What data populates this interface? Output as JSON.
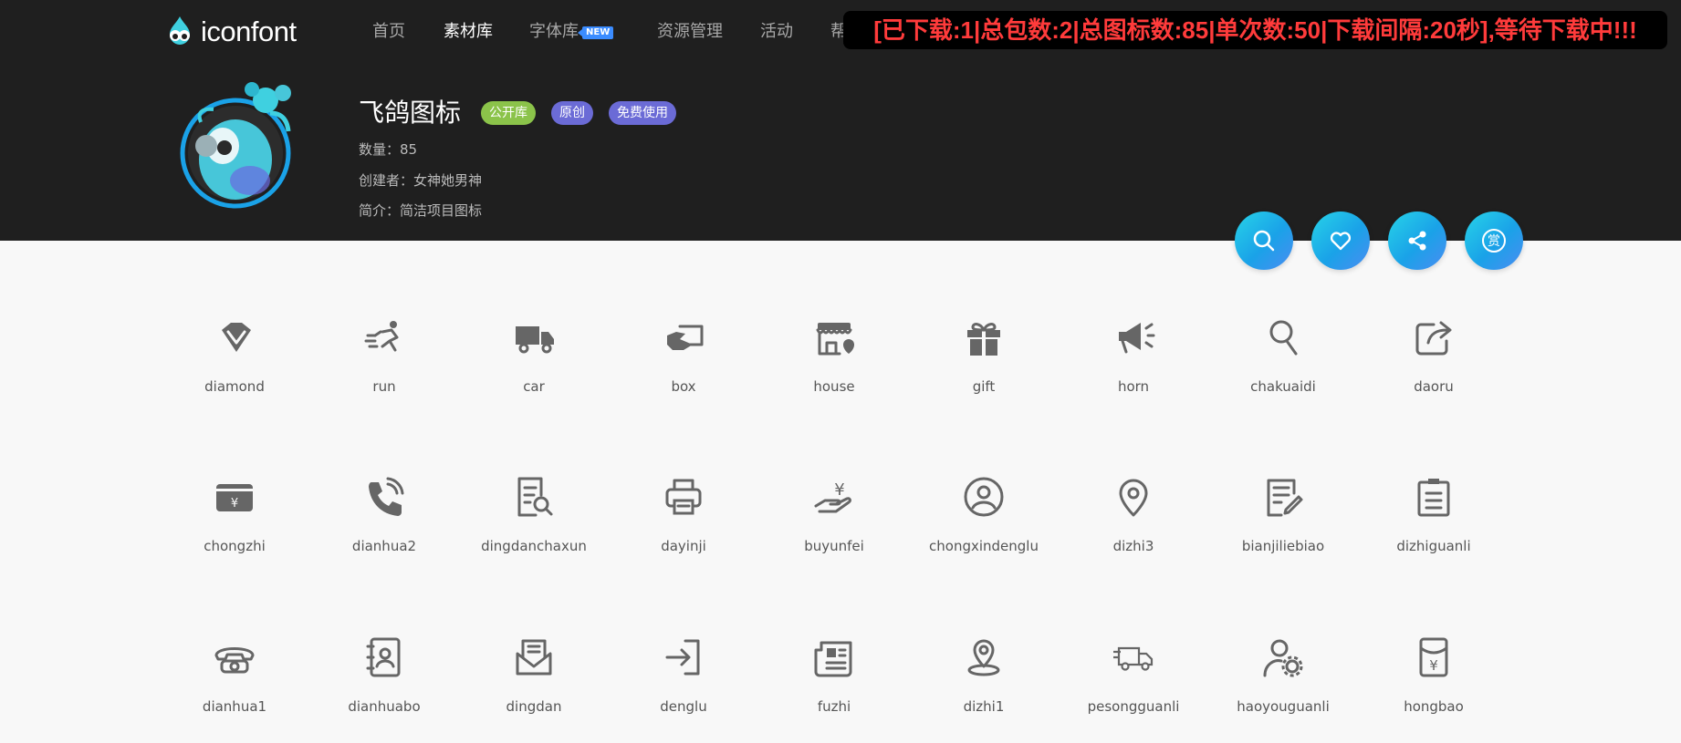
{
  "app": {
    "logo_text": "iconfont"
  },
  "nav": {
    "items": [
      {
        "label": "首页"
      },
      {
        "label": "素材库"
      },
      {
        "label": "字体库",
        "badge": "NEW"
      },
      {
        "label": "资源管理"
      },
      {
        "label": "活动"
      },
      {
        "label": "帮"
      }
    ],
    "active_index": 1
  },
  "banner": {
    "text": "[已下载:1|总包数:2|总图标数:85|单次数:50|下载间隔:20秒],等待下载中!!!"
  },
  "library": {
    "title": "飞鸽图标",
    "tags": [
      "公开库",
      "原创",
      "免费使用"
    ],
    "count_label": "数量：",
    "count_value": "85",
    "creator_label": "创建者：",
    "creator_value": "女神她男神",
    "desc_label": "简介：",
    "desc_value": "简洁项目图标"
  },
  "actions": [
    {
      "name": "search-icon"
    },
    {
      "name": "heart-icon"
    },
    {
      "name": "share-icon"
    },
    {
      "name": "reward-icon",
      "glyph": "赏"
    }
  ],
  "colors": {
    "hero_bg": "#1f1f1f",
    "banner_text": "#ff3b3b",
    "tag_green": "#8bc34a",
    "tag_purple": "#6b6bd6",
    "fab_gradient_start": "#27d3e8",
    "fab_gradient_end": "#4b8cf2",
    "icon_gray": "#666666"
  },
  "icons": [
    {
      "label": "diamond",
      "icon": "diamond-icon"
    },
    {
      "label": "run",
      "icon": "run-icon"
    },
    {
      "label": "car",
      "icon": "truck-icon"
    },
    {
      "label": "box",
      "icon": "box-icon"
    },
    {
      "label": "house",
      "icon": "store-icon"
    },
    {
      "label": "gift",
      "icon": "gift-icon"
    },
    {
      "label": "horn",
      "icon": "megaphone-icon"
    },
    {
      "label": "chakuaidi",
      "icon": "magnifier-icon"
    },
    {
      "label": "daoru",
      "icon": "export-icon"
    },
    {
      "label": "chongzhi",
      "icon": "recharge-card-icon",
      "glyph": "¥"
    },
    {
      "label": "dianhua2",
      "icon": "phone-call-icon"
    },
    {
      "label": "dingdanchaxun",
      "icon": "order-search-icon"
    },
    {
      "label": "dayinji",
      "icon": "printer-icon"
    },
    {
      "label": "buyunfei",
      "icon": "hand-yen-icon",
      "glyph": "¥"
    },
    {
      "label": "chongxindenglu",
      "icon": "user-circle-icon"
    },
    {
      "label": "dizhi3",
      "icon": "location-pin-icon"
    },
    {
      "label": "bianjiliebiao",
      "icon": "edit-list-icon"
    },
    {
      "label": "dizhiguanli",
      "icon": "clipboard-list-icon"
    },
    {
      "label": "dianhua1",
      "icon": "telephone-icon"
    },
    {
      "label": "dianhuabo",
      "icon": "contact-book-icon"
    },
    {
      "label": "dingdan",
      "icon": "mail-order-icon"
    },
    {
      "label": "denglu",
      "icon": "login-icon"
    },
    {
      "label": "fuzhi",
      "icon": "newspaper-icon"
    },
    {
      "label": "dizhi1",
      "icon": "map-pin-icon"
    },
    {
      "label": "pesongguanli",
      "icon": "delivery-truck-icon"
    },
    {
      "label": "haoyouguanli",
      "icon": "user-settings-icon"
    },
    {
      "label": "hongbao",
      "icon": "red-envelope-icon",
      "glyph": "¥"
    }
  ]
}
